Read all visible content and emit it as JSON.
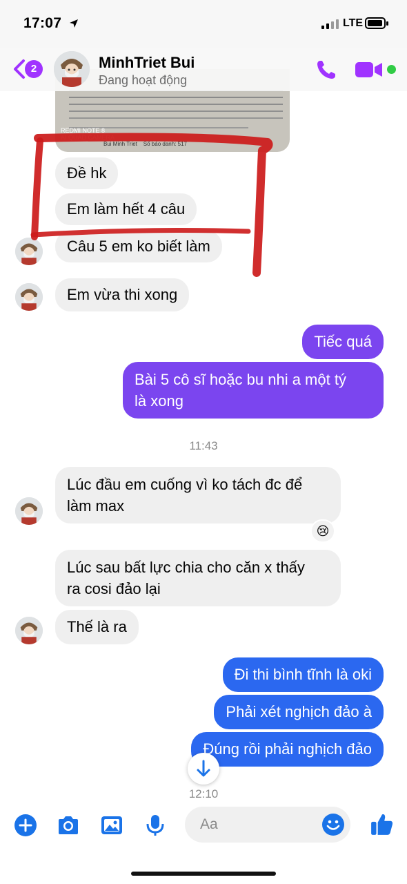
{
  "status_bar": {
    "time": "17:07",
    "network": "LTE"
  },
  "header": {
    "unread_badge": "2",
    "contact_name": "MinhTriet Bui",
    "contact_status": "Đang hoạt động"
  },
  "photo": {
    "camera_caption": "REDMI NOTE 8\nAI QUAD CAMERA",
    "footer_text": "Bui Minh Triet    Số báo danh: 517"
  },
  "messages": [
    {
      "side": "in",
      "text": "Đề hk"
    },
    {
      "side": "in",
      "text": "Em làm hết 4 câu"
    },
    {
      "side": "in",
      "text": "Câu 5 em ko biết làm"
    },
    {
      "side": "in",
      "text": "Em vừa thi xong"
    },
    {
      "side": "out",
      "text": "Tiếc quá"
    },
    {
      "side": "out",
      "text": "Bài 5 cô sĩ hoặc bu nhi a một tý\nlà xong"
    },
    {
      "side": "in",
      "text": "Lúc đầu em cuống vì ko tách đc để\nlàm max"
    },
    {
      "side": "in",
      "text": "Lúc sau bất lực chia cho căn x thấy\nra cosi đảo lại"
    },
    {
      "side": "in",
      "text": "Thế là ra"
    },
    {
      "side": "out",
      "text": "Đi thi bình tĩnh là oki"
    },
    {
      "side": "out",
      "text": "Phải xét nghịch đảo à"
    },
    {
      "side": "out",
      "text": "Đúng rồi phải nghịch đảo"
    }
  ],
  "timestamps": [
    "11:43",
    "12:10"
  ],
  "reaction": "😢",
  "composer": {
    "placeholder": "Aa"
  },
  "colors": {
    "messenger_purple": "#7b45ef",
    "messenger_blue": "#2b68f0",
    "icon_blue": "#1a73e8",
    "header_purple": "#a033ff",
    "incoming_bubble": "#efefef",
    "annotation_red": "#cc1a1a",
    "active_green": "#31cc46"
  },
  "icons": [
    "location-arrow-icon",
    "signal-icon",
    "battery-icon",
    "back-chevron-icon",
    "phone-icon",
    "video-camera-icon",
    "arrow-down-icon",
    "plus-icon",
    "camera-icon",
    "image-icon",
    "microphone-icon",
    "smiley-icon",
    "thumbs-up-icon"
  ]
}
